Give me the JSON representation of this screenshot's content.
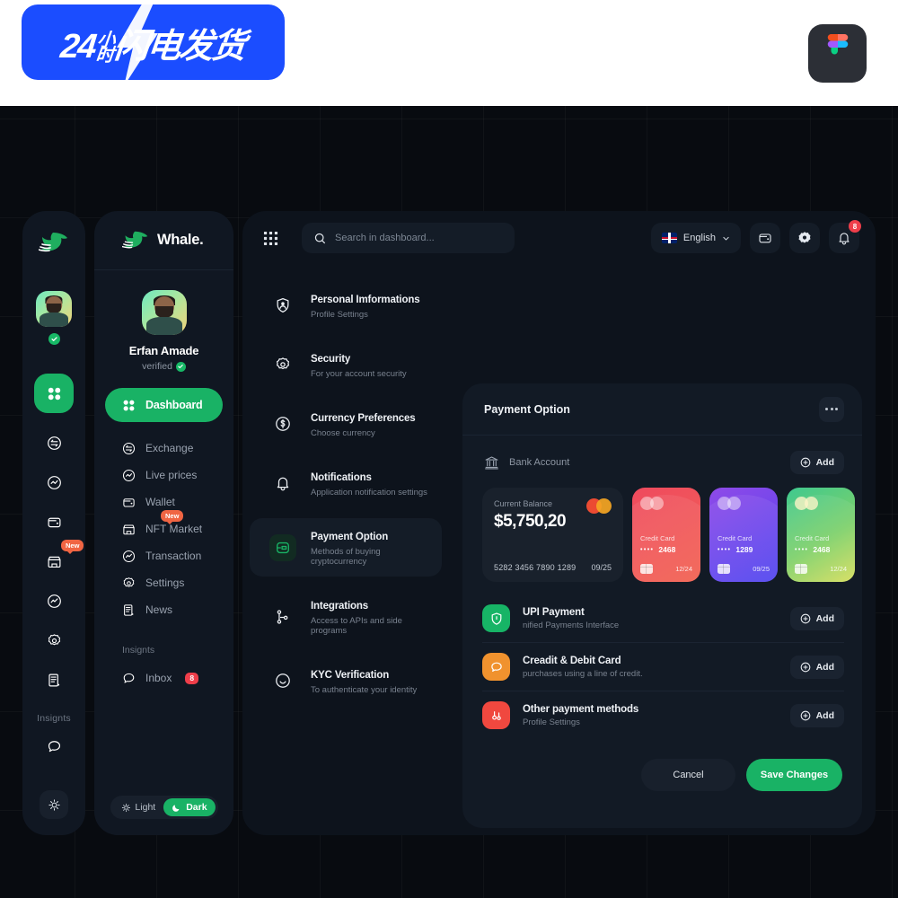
{
  "banner": {
    "promo_text_main": "24",
    "promo_text_small_top": "小",
    "promo_text_small_bottom": "时",
    "promo_text_rest": "闪电发货",
    "figma_icon": "figma-logo-icon"
  },
  "icon_rail": {
    "logo": "whale-logo-icon",
    "verified_icon": "check-circle-icon",
    "items": [
      {
        "icon": "grid-apps-icon",
        "name": "dashboard",
        "active": true
      },
      {
        "icon": "exchange-icon",
        "name": "exchange",
        "active": false
      },
      {
        "icon": "live-prices-icon",
        "name": "live-prices",
        "active": false
      },
      {
        "icon": "wallet-icon",
        "name": "wallet",
        "active": false
      },
      {
        "icon": "nft-market-icon",
        "name": "nft-market",
        "active": false,
        "badge": "New"
      },
      {
        "icon": "transaction-icon",
        "name": "transaction",
        "active": false
      },
      {
        "icon": "settings-gear-icon",
        "name": "settings",
        "active": false
      },
      {
        "icon": "news-icon",
        "name": "news",
        "active": false
      }
    ],
    "section_label": "Insignts",
    "inbox_icon": "chat-bubble-icon",
    "theme_icon": "sun-icon"
  },
  "sidebar": {
    "brand": "Whale.",
    "logo": "whale-logo-icon",
    "profile": {
      "name": "Erfan Amade",
      "status": "verified",
      "verified_icon": "check-circle-icon"
    },
    "active_item": {
      "label": "Dashboard",
      "icon": "grid-apps-icon"
    },
    "items": [
      {
        "label": "Exchange",
        "icon": "exchange-icon"
      },
      {
        "label": "Live prices",
        "icon": "live-prices-icon"
      },
      {
        "label": "Wallet",
        "icon": "wallet-icon"
      },
      {
        "label": "NFT Market",
        "icon": "nft-market-icon",
        "badge": "New"
      },
      {
        "label": "Transaction",
        "icon": "transaction-icon"
      },
      {
        "label": "Settings",
        "icon": "settings-gear-icon"
      },
      {
        "label": "News",
        "icon": "news-icon"
      }
    ],
    "section_label": "Insignts",
    "inbox": {
      "label": "Inbox",
      "badge": "8",
      "icon": "chat-bubble-icon"
    },
    "theme": {
      "light_label": "Light",
      "dark_label": "Dark",
      "light_icon": "sun-icon",
      "dark_icon": "moon-icon",
      "active": "Dark"
    }
  },
  "topbar": {
    "grid_icon": "apps-grid-icon",
    "search": {
      "placeholder": "Search in dashboard...",
      "value": "",
      "icon": "search-icon"
    },
    "language": {
      "label": "English",
      "flag": "uk-flag-icon",
      "chevron": "chevron-down-icon"
    },
    "wallet_icon": "wallet-icon",
    "settings_icon": "gear-icon",
    "notifications": {
      "icon": "bell-icon",
      "count": "8"
    }
  },
  "settings_menu": [
    {
      "title": "Personal Imformations",
      "subtitle": "Profile Settings",
      "icon": "user-shield-icon",
      "active": false
    },
    {
      "title": "Security",
      "subtitle": "For your account security",
      "icon": "gear-shield-icon",
      "active": false
    },
    {
      "title": "Currency Preferences",
      "subtitle": "Choose currency",
      "icon": "dollar-circle-icon",
      "active": false
    },
    {
      "title": "Notifications",
      "subtitle": "Application notification settings",
      "icon": "bell-icon",
      "active": false
    },
    {
      "title": "Payment Option",
      "subtitle": "Methods of buying cryptocurrency",
      "icon": "card-payment-icon",
      "active": true
    },
    {
      "title": "Integrations",
      "subtitle": "Access to APIs and side programs",
      "icon": "integrations-node-icon",
      "active": false
    },
    {
      "title": "KYC Verification",
      "subtitle": "To authenticate your identity",
      "icon": "smiley-face-icon",
      "active": false
    }
  ],
  "payment_panel": {
    "title": "Payment Option",
    "more_icon": "ellipsis-icon",
    "bank_section": {
      "label": "Bank Account",
      "icon": "bank-building-icon",
      "add_label": "Add",
      "add_icon": "plus-circle-icon"
    },
    "balance_card": {
      "label": "Current Balance",
      "amount": "$5,750,20",
      "number": "5282 3456 7890 1289",
      "expiry": "09/25",
      "network_icon": "mastercard-icon"
    },
    "credit_cards": [
      {
        "label": "Credit Card",
        "dots": "••••",
        "last4": "2468",
        "expiry": "12/24",
        "color": "red",
        "accent": "#ef4a5e"
      },
      {
        "label": "Credit Card",
        "dots": "••••",
        "last4": "1289",
        "expiry": "09/25",
        "color": "purple",
        "accent": "#6f46ec"
      },
      {
        "label": "Credit Card",
        "dots": "••••",
        "last4": "2468",
        "expiry": "12/24",
        "color": "green",
        "accent": "#7cd06a"
      }
    ],
    "methods": [
      {
        "title": "UPI Payment",
        "subtitle": "nified Payments Interface",
        "icon": "shield-icon",
        "color": "#17b466",
        "add_label": "Add"
      },
      {
        "title": "Creadit & Debit Card",
        "subtitle": "purchases using a line of credit.",
        "icon": "chat-bubble-icon",
        "color": "#f0922e",
        "add_label": "Add"
      },
      {
        "title": "Other payment methods",
        "subtitle": "Profile Settings",
        "icon": "keys-icon",
        "color": "#f0483f",
        "add_label": "Add"
      }
    ],
    "actions": {
      "cancel_label": "Cancel",
      "save_label": "Save Changes"
    }
  },
  "colors": {
    "accent_green": "#19b265",
    "canvas_bg": "#080b10",
    "panel_bg": "#0d131c",
    "card_bg": "#121a25",
    "sidebar_bg": "#101722",
    "badge_red": "#ef3e4a",
    "badge_orange": "#f06543",
    "promo_blue": "#1b4dff"
  }
}
